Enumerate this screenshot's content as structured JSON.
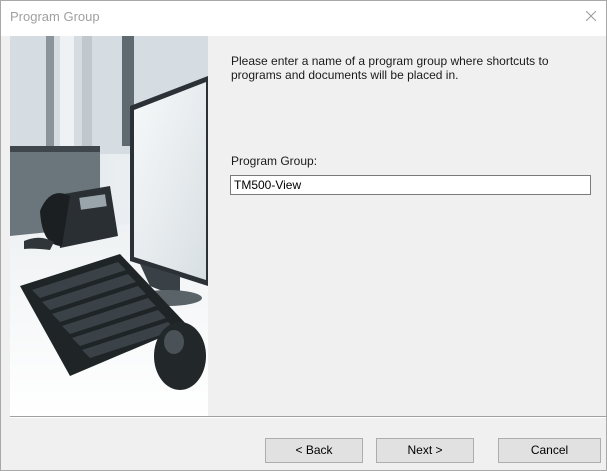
{
  "window": {
    "title": "Program Group"
  },
  "content": {
    "instruction": "Please enter a name of a program group where shortcuts to programs and documents will be placed in.",
    "group_label": "Program Group:",
    "group_value": "TM500-View"
  },
  "buttons": {
    "back": "< Back",
    "next": "Next >",
    "cancel": "Cancel"
  },
  "icons": {
    "close": "close-icon"
  },
  "colors": {
    "title_text": "#a0a0a0",
    "dialog_bg": "#f0f0f0",
    "button_bg": "#e1e1e1"
  }
}
